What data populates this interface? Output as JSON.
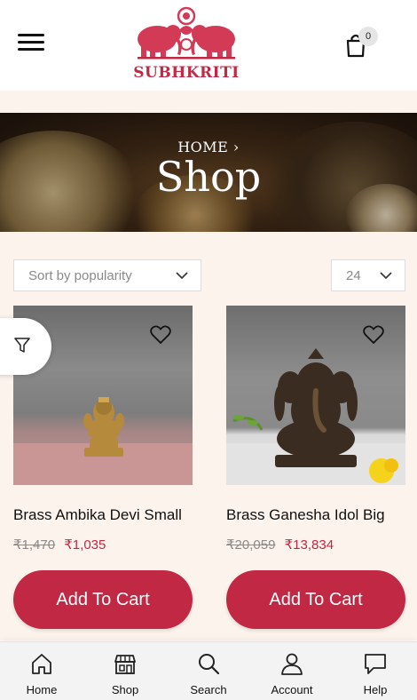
{
  "brand": {
    "name": "SUBHKRITI",
    "accent_color": "#c12843"
  },
  "header": {
    "menu_icon": "hamburger-icon",
    "cart_icon": "shopping-bag-icon",
    "cart_count": "0"
  },
  "banner": {
    "breadcrumb": "HOME ›",
    "title": "Shop"
  },
  "controls": {
    "sort_value": "Sort by popularity",
    "per_page_value": "24",
    "filter_icon": "filter-icon"
  },
  "products": [
    {
      "name": "Brass Ambika Devi Small",
      "old_price": "₹1,470",
      "new_price": "₹1,035",
      "button": "Add To Cart"
    },
    {
      "name": "Brass Ganesha Idol Big",
      "old_price": "₹20,059",
      "new_price": "₹13,834",
      "button": "Add To Cart"
    }
  ],
  "bottom_nav": [
    {
      "label": "Home",
      "icon": "home-icon"
    },
    {
      "label": "Shop",
      "icon": "store-icon"
    },
    {
      "label": "Search",
      "icon": "search-icon"
    },
    {
      "label": "Account",
      "icon": "user-icon"
    },
    {
      "label": "Help",
      "icon": "chat-icon"
    }
  ]
}
